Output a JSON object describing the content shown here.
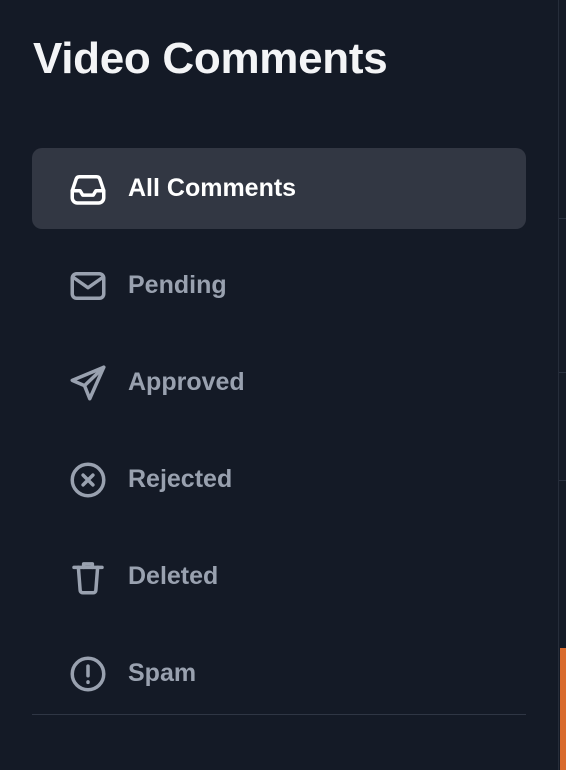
{
  "header": {
    "title": "Video Comments"
  },
  "nav": {
    "items": [
      {
        "label": "All Comments",
        "icon": "inbox-icon",
        "active": true
      },
      {
        "label": "Pending",
        "icon": "mail-icon",
        "active": false
      },
      {
        "label": "Approved",
        "icon": "send-icon",
        "active": false
      },
      {
        "label": "Rejected",
        "icon": "x-circle-icon",
        "active": false
      },
      {
        "label": "Deleted",
        "icon": "trash-icon",
        "active": false
      },
      {
        "label": "Spam",
        "icon": "alert-circle-icon",
        "active": false
      }
    ]
  },
  "colors": {
    "background": "#141a26",
    "active_background": "#323743",
    "active_text": "#ffffff",
    "inactive_text": "#99a1af",
    "accent": "#d96a2c"
  }
}
